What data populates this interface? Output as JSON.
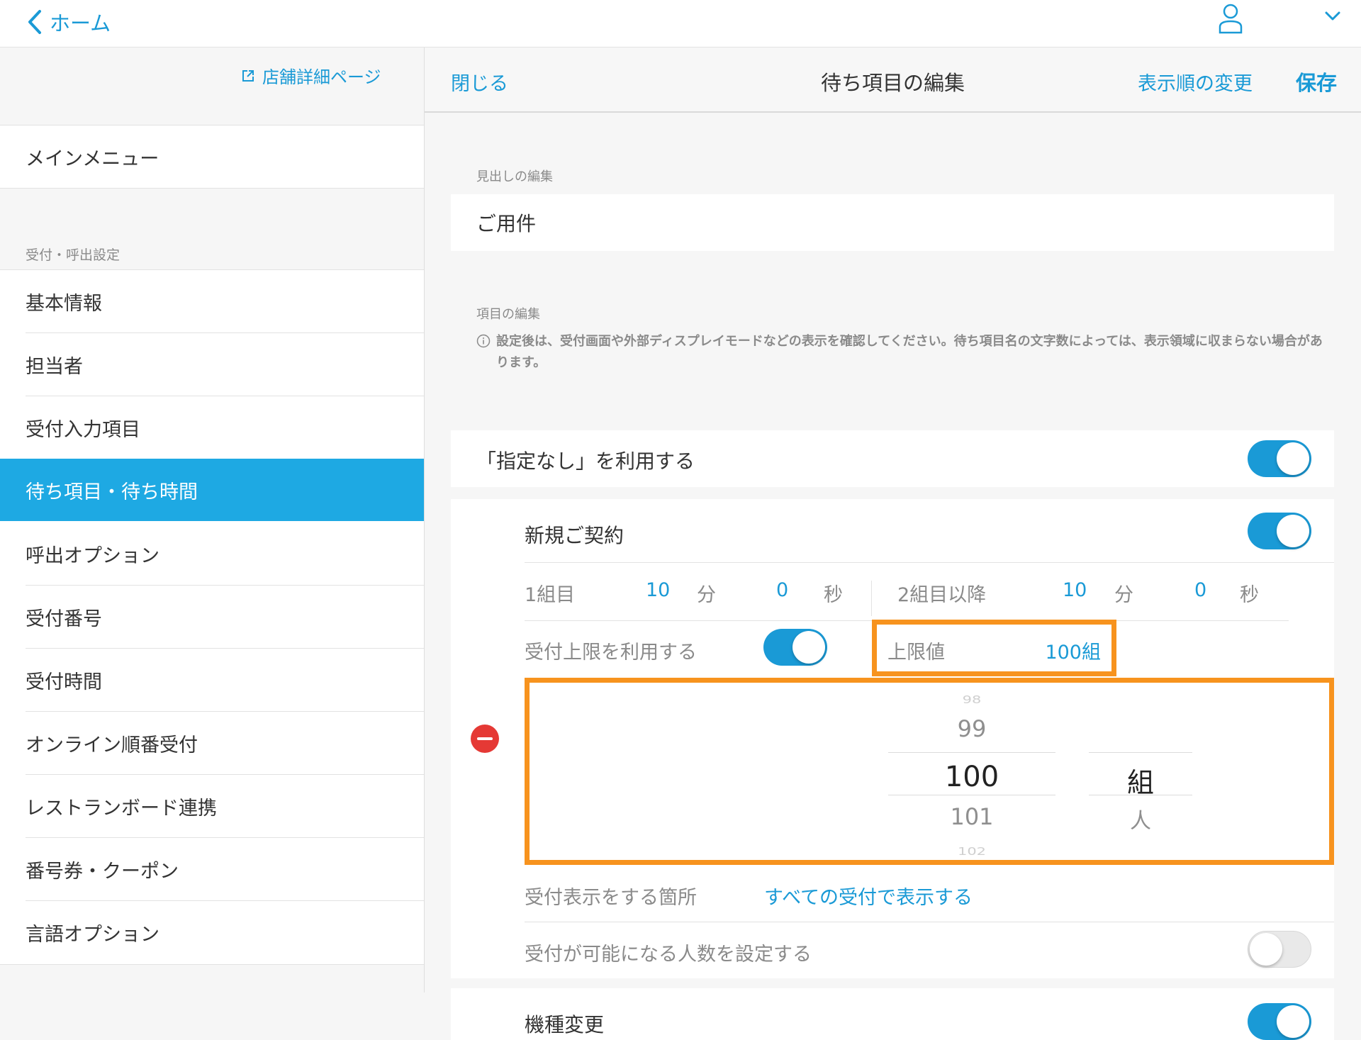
{
  "nav": {
    "back_label": "ホーム"
  },
  "sidebar": {
    "store_link": "店舗詳細ページ",
    "main_menu": "メインメニュー",
    "section_label": "受付・呼出設定",
    "items": [
      {
        "label": "基本情報"
      },
      {
        "label": "担当者"
      },
      {
        "label": "受付入力項目"
      },
      {
        "label": "待ち項目・待ち時間",
        "selected": true
      },
      {
        "label": "呼出オプション"
      },
      {
        "label": "受付番号"
      },
      {
        "label": "受付時間"
      },
      {
        "label": "オンライン順番受付"
      },
      {
        "label": "レストランボード連携"
      },
      {
        "label": "番号券・クーポン"
      },
      {
        "label": "言語オプション"
      }
    ]
  },
  "header": {
    "close_label": "閉じる",
    "title": "待ち項目の編集",
    "reorder_label": "表示順の変更",
    "save_label": "保存"
  },
  "heading_section": {
    "label": "見出しの編集",
    "value": "ご用件"
  },
  "items_section": {
    "label": "項目の編集",
    "note": "設定後は、受付画面や外部ディスプレイモードなどの表示を確認してください。待ち項目名の文字数によっては、表示領域に収まらない場合があります。",
    "no_preference_label": "「指定なし」を利用する",
    "no_preference_on": true
  },
  "item1": {
    "name": "新規ご契約",
    "enabled": true,
    "first_group_label": "1組目",
    "first_min": "10",
    "min_unit": "分",
    "first_sec": "0",
    "sec_unit": "秒",
    "later_group_label": "2組目以降",
    "later_min": "10",
    "later_sec": "0",
    "limit_toggle_label": "受付上限を利用する",
    "limit_on": true,
    "limit_label": "上限値",
    "limit_value": "100組",
    "picker": {
      "numbers": [
        "98",
        "99",
        "100",
        "101",
        "102"
      ],
      "selected_number": "100",
      "units": [
        "組",
        "人"
      ],
      "selected_unit": "組"
    },
    "display_label": "受付表示をする箇所",
    "display_value": "すべての受付で表示する",
    "capacity_label": "受付が可能になる人数を設定する",
    "capacity_on": false
  },
  "item2": {
    "name": "機種変更",
    "enabled": true
  },
  "colors": {
    "accent": "#1a9ad6",
    "highlight": "#f7931e",
    "delete": "#e53935"
  }
}
